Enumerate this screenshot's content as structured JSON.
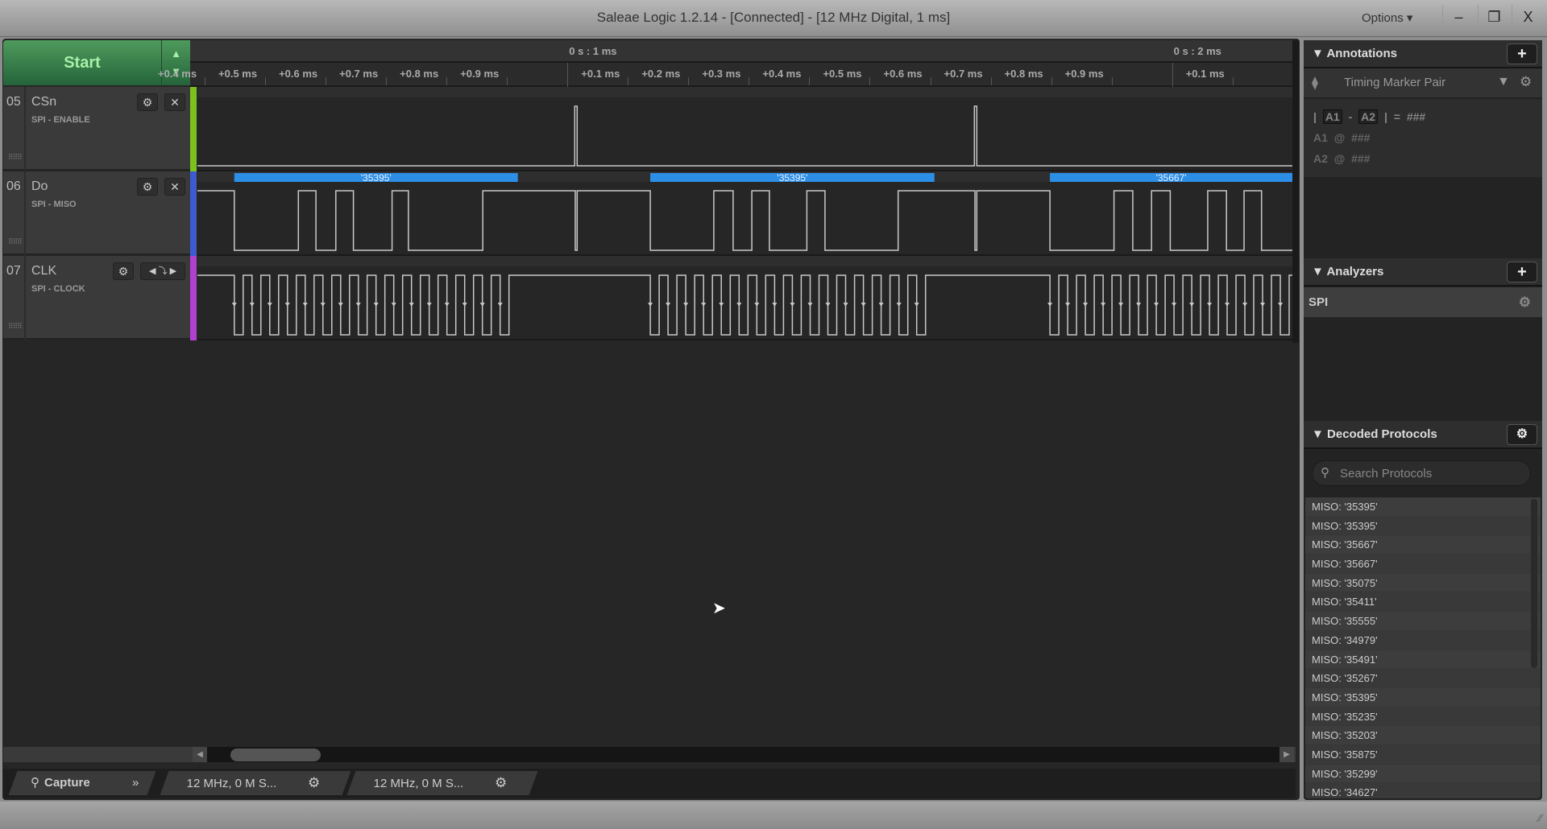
{
  "window": {
    "title": "Saleae Logic 1.2.14 - [Connected] - [12 MHz Digital, 1 ms]",
    "options_label": "Options ▾",
    "minimize": "–",
    "restore": "❐",
    "close": "X"
  },
  "capture": {
    "start_label": "Start"
  },
  "ruler": {
    "major": [
      {
        "t": 1.0,
        "label": "0 s : 1 ms"
      },
      {
        "t": 2.0,
        "label": "0 s : 2 ms"
      }
    ],
    "minor": [
      {
        "t": 0.4,
        "label": "+0.4 ms"
      },
      {
        "t": 0.5,
        "label": "+0.5 ms"
      },
      {
        "t": 0.6,
        "label": "+0.6 ms"
      },
      {
        "t": 0.7,
        "label": "+0.7 ms"
      },
      {
        "t": 0.8,
        "label": "+0.8 ms"
      },
      {
        "t": 0.9,
        "label": "+0.9 ms"
      },
      {
        "t": 1.1,
        "label": "+0.1 ms"
      },
      {
        "t": 1.2,
        "label": "+0.2 ms"
      },
      {
        "t": 1.3,
        "label": "+0.3 ms"
      },
      {
        "t": 1.4,
        "label": "+0.4 ms"
      },
      {
        "t": 1.5,
        "label": "+0.5 ms"
      },
      {
        "t": 1.6,
        "label": "+0.6 ms"
      },
      {
        "t": 1.7,
        "label": "+0.7 ms"
      },
      {
        "t": 1.8,
        "label": "+0.8 ms"
      },
      {
        "t": 1.9,
        "label": "+0.9 ms"
      },
      {
        "t": 2.1,
        "label": "+0.1 ms"
      }
    ],
    "view_ms": [
      0.388,
      2.199
    ]
  },
  "channels": [
    {
      "num": "05",
      "name": "CSn",
      "role": "SPI - ENABLE",
      "color": "#7cc21f",
      "initial": 0,
      "edges": [
        1.012,
        1.016,
        1.673,
        1.677
      ]
    },
    {
      "num": "06",
      "name": "Do",
      "role": "SPI - MISO",
      "color": "#3d5ad0",
      "initial": 1,
      "edges": [
        0.449,
        0.555,
        0.584,
        0.617,
        0.646,
        0.71,
        0.737,
        0.86,
        1.013,
        1.016,
        1.137,
        1.242,
        1.274,
        1.305,
        1.334,
        1.396,
        1.426,
        1.547,
        1.674,
        1.677,
        1.798,
        1.904,
        1.935,
        1.966,
        1.997,
        2.059,
        2.09,
        2.119,
        2.148
      ],
      "frames": [
        {
          "start": 0.449,
          "end": 0.918,
          "label": "'35395'"
        },
        {
          "start": 1.137,
          "end": 1.607,
          "label": "'35395'"
        },
        {
          "start": 1.798,
          "end": 2.267,
          "label": "'35667'"
        }
      ]
    },
    {
      "num": "07",
      "name": "CLK",
      "role": "SPI - CLOCK",
      "color": "#b040d0",
      "initial": 1,
      "bursts": [
        {
          "start": 0.449,
          "end": 0.918,
          "cycles": 16
        },
        {
          "start": 1.137,
          "end": 1.607,
          "cycles": 16
        },
        {
          "start": 1.798,
          "end": 2.267,
          "cycles": 16
        }
      ]
    }
  ],
  "tabs": {
    "capture": "Capture",
    "more": "»",
    "session1": "12 MHz, 0 M S...",
    "session2": "12 MHz, 0 M S..."
  },
  "annotations": {
    "title": "Annotations",
    "marker_type": "Timing Marker Pair",
    "a1": "A1",
    "a2": "A2",
    "diff_value": "###",
    "a1_line": "A1  @  ###",
    "a2_line": "A2  @  ###",
    "pipe": "|",
    "minus": "-",
    "equals": "| =",
    "at": "@"
  },
  "analyzers": {
    "title": "Analyzers",
    "items": [
      {
        "label": "SPI"
      }
    ]
  },
  "decoded": {
    "title": "Decoded Protocols",
    "search_placeholder": "Search Protocols",
    "items": [
      "MISO: '35395'",
      "MISO: '35395'",
      "MISO: '35667'",
      "MISO: '35667'",
      "MISO: '35075'",
      "MISO: '35411'",
      "MISO: '35555'",
      "MISO: '34979'",
      "MISO: '35491'",
      "MISO: '35267'",
      "MISO: '35395'",
      "MISO: '35235'",
      "MISO: '35203'",
      "MISO: '35875'",
      "MISO: '35299'",
      "MISO: '34627'"
    ]
  }
}
